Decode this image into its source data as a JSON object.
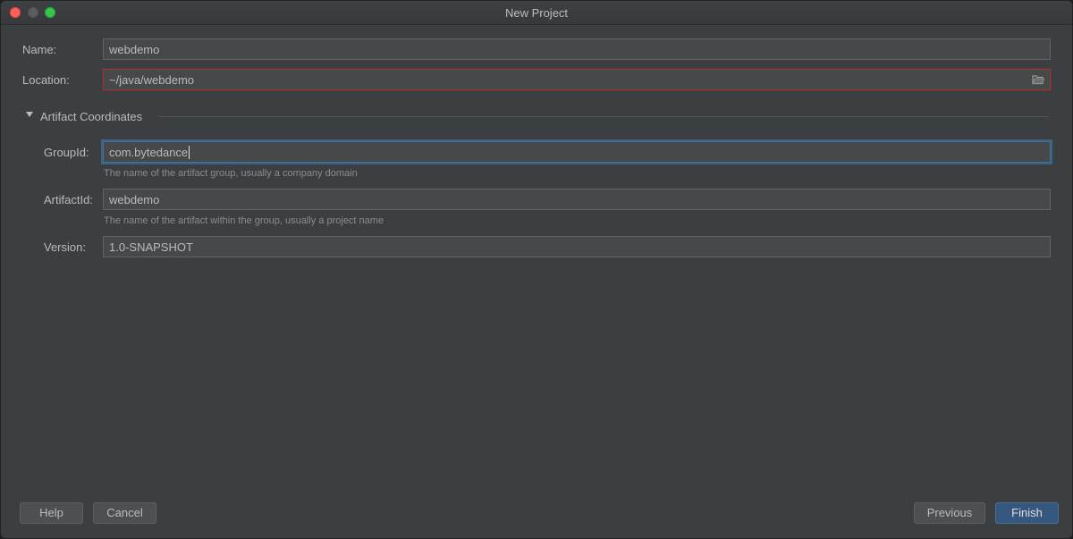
{
  "window": {
    "title": "New Project"
  },
  "form": {
    "name_label": "Name:",
    "name_value": "webdemo",
    "location_label": "Location:",
    "location_value": "~/java/webdemo",
    "location_browse_icon": "folder-icon"
  },
  "artifact_section": {
    "title": "Artifact Coordinates",
    "expanded": true,
    "group_id_label": "GroupId:",
    "group_id_value": "com.bytedance",
    "group_id_hint": "The name of the artifact group, usually a company domain",
    "artifact_id_label": "ArtifactId:",
    "artifact_id_value": "webdemo",
    "artifact_id_hint": "The name of the artifact within the group, usually a project name",
    "version_label": "Version:",
    "version_value": "1.0-SNAPSHOT"
  },
  "buttons": {
    "help": "Help",
    "cancel": "Cancel",
    "previous": "Previous",
    "finish": "Finish"
  },
  "colors": {
    "background": "#3c3f41",
    "field_background": "#45494a",
    "error_border": "#8b3c3c",
    "focus_border": "#466d94",
    "primary_button": "#365880"
  }
}
